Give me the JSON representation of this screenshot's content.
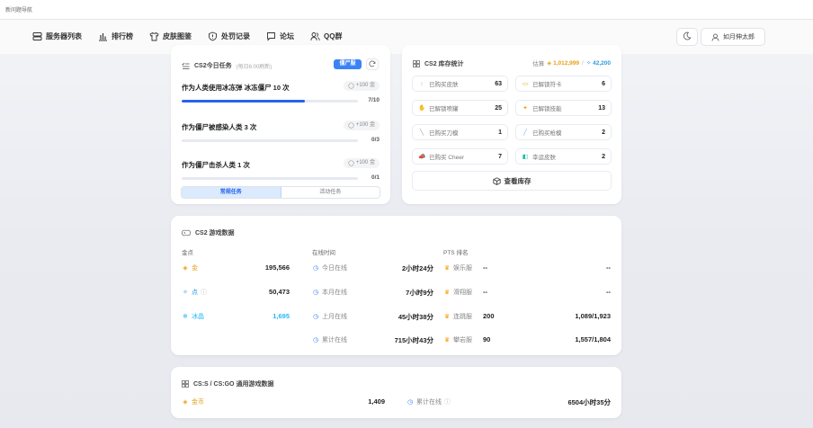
{
  "topstrip": {
    "text": "新问题导航"
  },
  "nav": {
    "items": [
      {
        "label": "服务器列表",
        "icon": "server-icon"
      },
      {
        "label": "排行榜",
        "icon": "bar-chart-icon"
      },
      {
        "label": "皮肤图鉴",
        "icon": "shirt-icon"
      },
      {
        "label": "处罚记录",
        "icon": "shield-icon"
      },
      {
        "label": "论坛",
        "icon": "chat-icon"
      },
      {
        "label": "QQ群",
        "icon": "users-icon"
      }
    ],
    "user_label": "如月伸太郎"
  },
  "tasks": {
    "title": "CS2今日任务",
    "subtitle": "(每日6:00刷新)",
    "mode_badge": "僵尸服",
    "items": [
      {
        "name": "作为人类使用冰冻弹 冰冻僵尸 10 次",
        "reward": "+100 金",
        "progress": "7/10",
        "fraction": 0.7
      },
      {
        "name": "作为僵尸被感染人类 3 次",
        "reward": "+100 金",
        "progress": "0/3",
        "fraction": 0.0
      },
      {
        "name": "作为僵尸击杀人类 1 次",
        "reward": "+100 金",
        "progress": "0/1",
        "fraction": 0.0
      }
    ],
    "tabs": [
      "常规任务",
      "活动任务"
    ]
  },
  "inventory": {
    "title": "CS2 库存统计",
    "valuation_label": "估算",
    "gold_value": "1,012,999",
    "sep": "/",
    "blue_value": "42,200",
    "items": [
      {
        "label": "已购买皮肤",
        "value": "63",
        "icon": "skin-icon"
      },
      {
        "label": "已解锁符卡",
        "value": "6",
        "icon": "card-icon"
      },
      {
        "label": "已解锁喷罐",
        "value": "25",
        "icon": "spray-icon"
      },
      {
        "label": "已解锁技能",
        "value": "13",
        "icon": "skill-icon"
      },
      {
        "label": "已购买刀模",
        "value": "1",
        "icon": "knife-icon"
      },
      {
        "label": "已购买枪模",
        "value": "2",
        "icon": "gun-icon"
      },
      {
        "label": "已购买 Cheer",
        "value": "7",
        "icon": "cheer-icon"
      },
      {
        "label": "幸运皮肤",
        "value": "2",
        "icon": "lucky-icon"
      }
    ],
    "view_button": "查看库存"
  },
  "gamedata": {
    "title": "CS2 游戏数据",
    "col_gold": "金点",
    "col_online": "在线时间",
    "col_pts": "PTS 排名",
    "gold_rows": [
      {
        "label": "金",
        "value": "195,566",
        "color": "#e6a115"
      },
      {
        "label": "点",
        "value": "50,473",
        "color": "#2b9be0"
      },
      {
        "label": "冰晶",
        "value": "1,695",
        "color": "#29b6f6"
      }
    ],
    "online_rows": [
      {
        "label": "今日在线",
        "value": "2小时24分"
      },
      {
        "label": "本月在线",
        "value": "7小时9分"
      },
      {
        "label": "上月在线",
        "value": "45小时38分"
      },
      {
        "label": "累计在线",
        "value": "715小时43分"
      }
    ],
    "pts_rows": [
      {
        "label": "娱乐服",
        "rank": "--",
        "score": "--"
      },
      {
        "label": "滑翔服",
        "rank": "--",
        "score": "--"
      },
      {
        "label": "连跳服",
        "rank": "200",
        "score": "1,089/1,923"
      },
      {
        "label": "攀岩服",
        "rank": "90",
        "score": "1,557/1,804"
      }
    ]
  },
  "csgo": {
    "title": "CS:S / CS:GO 通用游戏数据",
    "coin_label": "金币",
    "coin_value": "1,409",
    "online_label": "累计在线",
    "online_value": "6504小时35分"
  }
}
